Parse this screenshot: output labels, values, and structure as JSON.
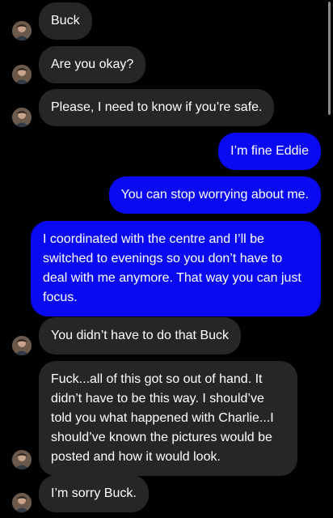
{
  "conversation": {
    "contact_avatar": "contact-avatar-photo",
    "colors": {
      "background": "#000000",
      "incoming_bubble": "#262628",
      "outgoing_bubble": "#0a0af2",
      "text": "#ffffff"
    },
    "messages": [
      {
        "direction": "incoming",
        "text": "Buck"
      },
      {
        "direction": "incoming",
        "text": "Are you okay?"
      },
      {
        "direction": "incoming",
        "text": "Please, I need to know if you’re safe."
      },
      {
        "direction": "outgoing",
        "text": "I’m fine Eddie"
      },
      {
        "direction": "outgoing",
        "text": "You can stop worrying about me."
      },
      {
        "direction": "outgoing",
        "text": "I coordinated with the centre and I’ll be switched to evenings so you don’t have to deal with me anymore. That way you can just focus."
      },
      {
        "direction": "incoming",
        "text": "You didn’t have to do that Buck"
      },
      {
        "direction": "incoming",
        "text": "Fuck...all of this got so out of hand. It didn’t have to be this way. I should’ve told you what happened with Charlie...I should’ve known the pictures would be posted and how it would look."
      },
      {
        "direction": "incoming",
        "text": "I’m sorry Buck."
      }
    ]
  }
}
